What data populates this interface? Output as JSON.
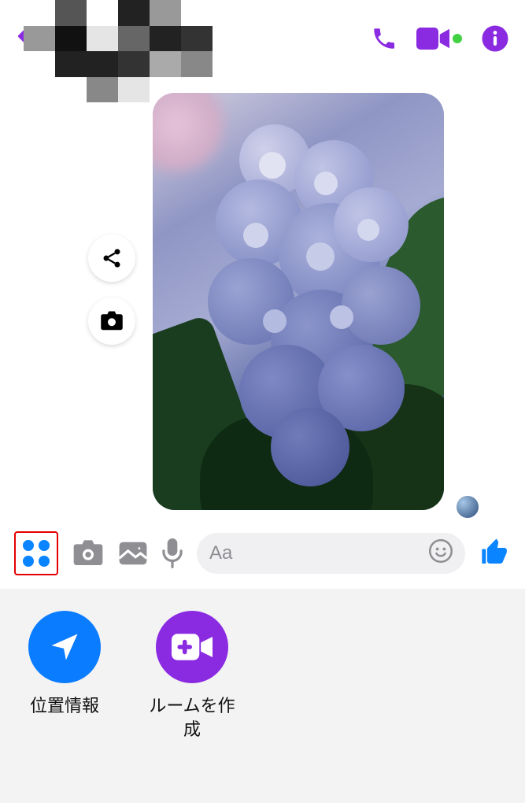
{
  "header": {
    "call_icon_name": "phone-icon",
    "video_icon_name": "video-icon",
    "info_icon_name": "info-icon"
  },
  "convo": {
    "share_name": "share-icon",
    "camera_name": "camera-icon"
  },
  "input": {
    "placeholder": "Aa",
    "more_name": "more-apps-icon",
    "camera_name": "camera-icon",
    "gallery_name": "gallery-icon",
    "mic_name": "microphone-icon",
    "emoji_name": "emoji-icon",
    "thumbs_name": "thumbs-up-icon"
  },
  "panel": {
    "location_label": "位置情報",
    "room_label": "ルームを作成"
  }
}
